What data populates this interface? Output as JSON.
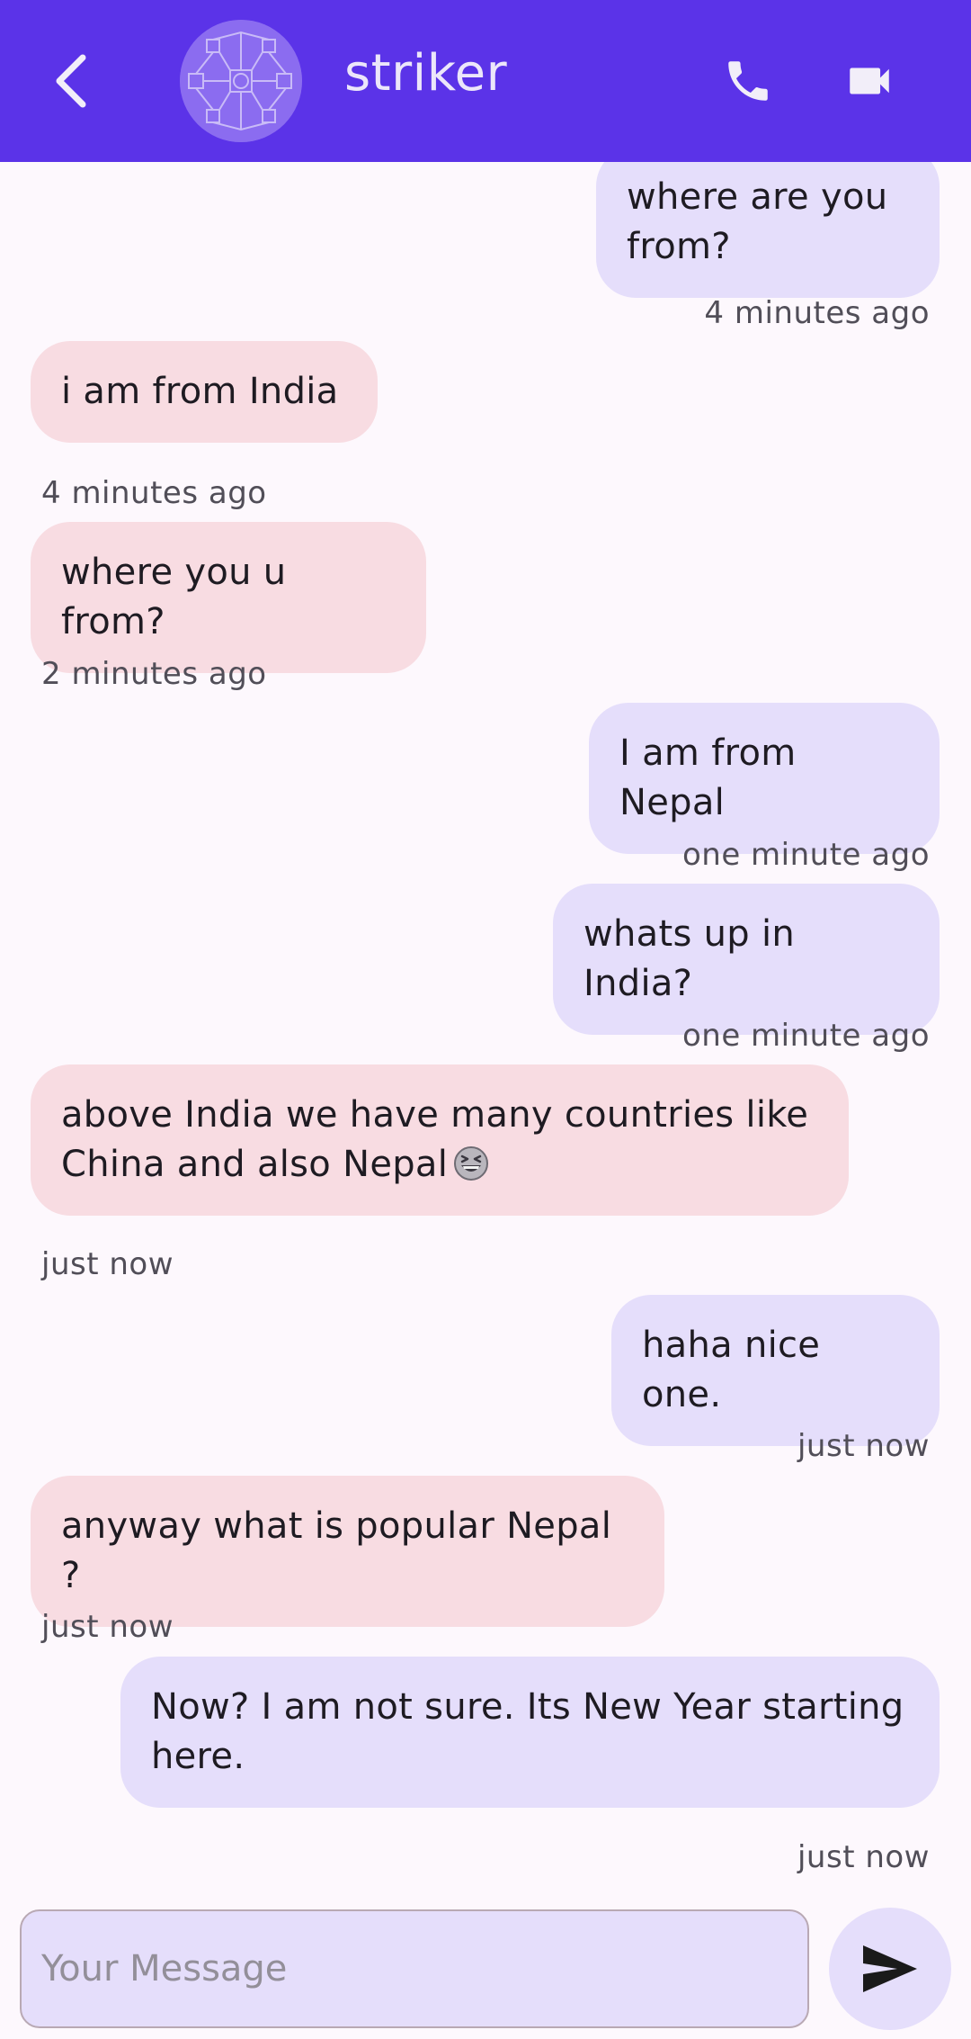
{
  "header": {
    "contact_name": "striker",
    "back_icon": "chevron-left-icon",
    "call_icon": "phone-icon",
    "video_icon": "videocam-icon"
  },
  "messages": [
    {
      "side": "sent",
      "text": "where are you from?",
      "time": "4 minutes ago"
    },
    {
      "side": "received",
      "text": "i am from India",
      "time": "4 minutes ago"
    },
    {
      "side": "received",
      "text": "where you u from?",
      "time": "2 minutes ago"
    },
    {
      "side": "sent",
      "text": "I am from Nepal",
      "time": "one minute ago"
    },
    {
      "side": "sent",
      "text": "whats up in India?",
      "time": "one minute ago"
    },
    {
      "side": "received",
      "text": "above India we have many countries like China and also Nepal",
      "emoji": "grinning-squinting-face-emoji",
      "time": "just now"
    },
    {
      "side": "sent",
      "text": "haha nice one.",
      "time": "just now"
    },
    {
      "side": "received",
      "text": "anyway what is popular Nepal ?",
      "time": "just now"
    },
    {
      "side": "sent",
      "text": "Now? I am not sure. Its New Year starting here.",
      "time": "just now"
    }
  ],
  "composer": {
    "placeholder": "Your Message",
    "value": "",
    "send_icon": "send-icon"
  },
  "colors": {
    "app_bar": "#5B33E8",
    "sent_bubble": "#E5DEFB",
    "received_bubble": "#F8DCE2",
    "background": "#FDF8FD"
  }
}
